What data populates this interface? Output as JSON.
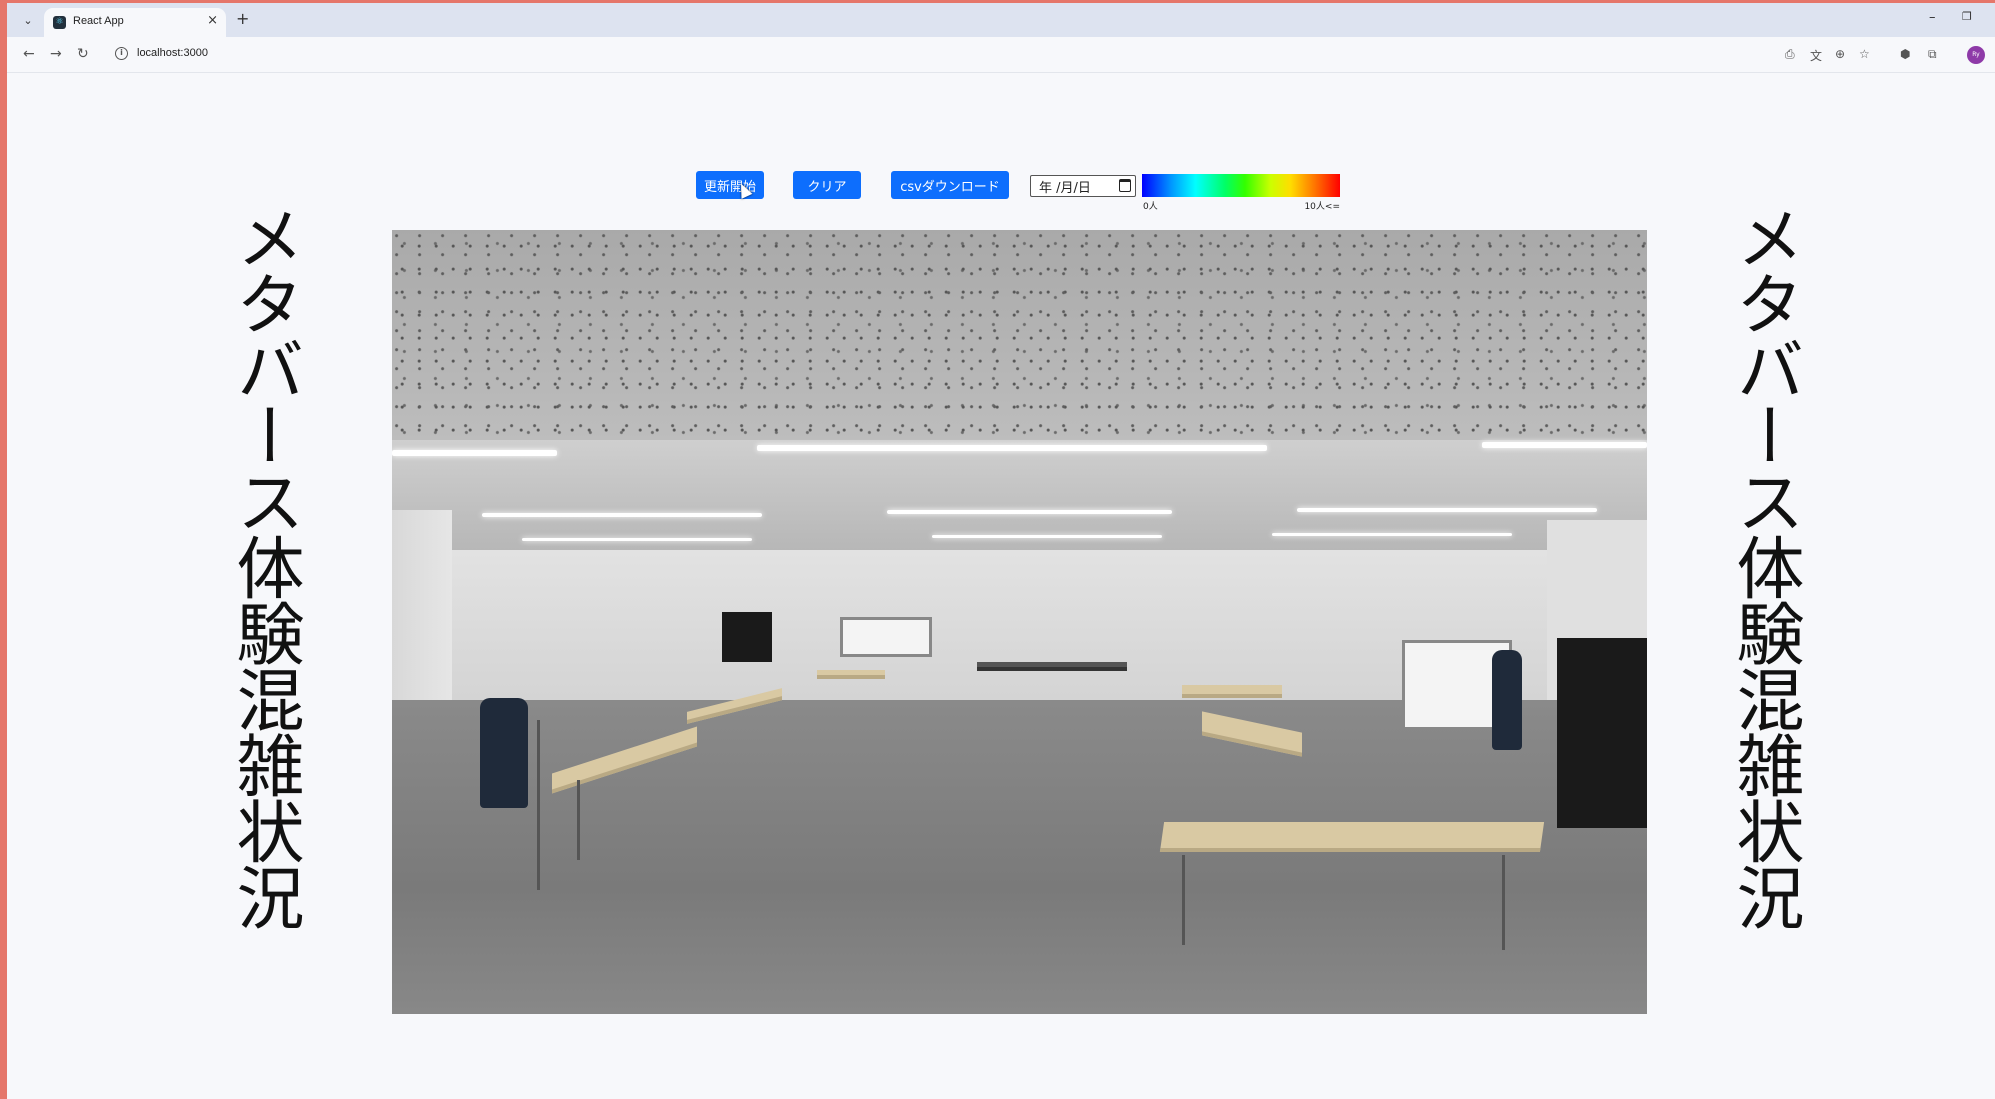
{
  "browser": {
    "tab_title": "React App",
    "tab_close": "×",
    "new_tab": "+",
    "url": "localhost:3000",
    "avatar_text": "Ry"
  },
  "controls": {
    "start_update_label": "更新開始",
    "clear_label": "クリア",
    "csv_download_label": "csvダウンロード",
    "date_placeholder": "年 /月/日"
  },
  "legend": {
    "min_label": "0人",
    "max_label": "10人<=",
    "colors": [
      "#0000ff",
      "#00ffff",
      "#00ff66",
      "#ccff00",
      "#ff7700",
      "#ff0000"
    ]
  },
  "page": {
    "title_left": "メタバース体験混雑状況",
    "title_right": "メタバース体験混雑状況"
  },
  "colors": {
    "primary_button": "#0d6efd",
    "page_background": "#f7f8fb"
  }
}
